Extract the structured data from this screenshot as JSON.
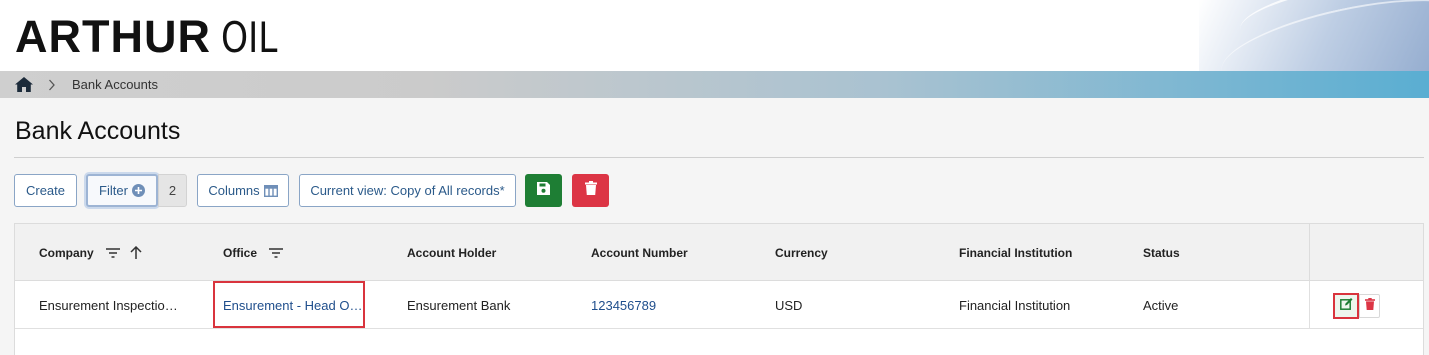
{
  "header": {
    "logo_main": "ARTHUR",
    "logo_secondary": "OIL"
  },
  "breadcrumb": {
    "home_icon": "home-icon",
    "separator_icon": "chevron-right-icon",
    "current": "Bank Accounts"
  },
  "page": {
    "title": "Bank Accounts"
  },
  "toolbar": {
    "create_label": "Create",
    "filter_label": "Filter",
    "filter_count": "2",
    "columns_label": "Columns",
    "view_label": "Current view: Copy of All records*",
    "save_icon": "save-icon",
    "delete_icon": "trash-icon"
  },
  "table": {
    "columns": [
      {
        "label": "Company",
        "filter_icon": true,
        "sort_icon": "arrow-up-icon"
      },
      {
        "label": "Office",
        "filter_icon": true
      },
      {
        "label": "Account Holder"
      },
      {
        "label": "Account Number"
      },
      {
        "label": "Currency"
      },
      {
        "label": "Financial Institution"
      },
      {
        "label": "Status"
      }
    ],
    "rows": [
      {
        "company": "Ensurement Inspectio…",
        "office": "Ensurement - Head O…",
        "account_holder": "Ensurement Bank",
        "account_number": "123456789",
        "currency": "USD",
        "financial_institution": "Financial Institution",
        "status": "Active",
        "actions": [
          "edit-icon",
          "trash-icon"
        ]
      }
    ]
  },
  "colors": {
    "primary_text": "#2b5a8a",
    "link": "#1f4e8c",
    "save_green": "#1e7e34",
    "delete_red": "#dc3545",
    "highlight_red": "#d9343d"
  }
}
